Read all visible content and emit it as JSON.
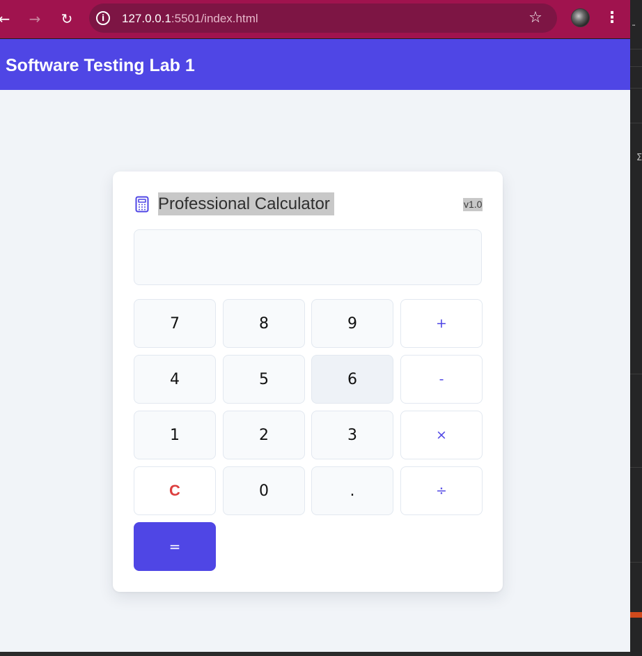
{
  "browser": {
    "url_host": "127.0.0.1",
    "url_rest": ":5501/index.html",
    "back_icon": "arrow-left-icon",
    "forward_icon": "arrow-right-icon",
    "reload_icon": "reload-icon",
    "bookmark_icon": "star-icon",
    "menu_icon": "kebab-menu-icon",
    "theme_color": "#a0134e"
  },
  "header": {
    "title": "Software Testing Lab 1",
    "color": "#4f46e5"
  },
  "calculator": {
    "title": "Professional Calculator",
    "version": "v1.0",
    "display_value": "",
    "keys": {
      "k7": "7",
      "k8": "8",
      "k9": "9",
      "plus": "+",
      "k4": "4",
      "k5": "5",
      "k6": "6",
      "minus": "-",
      "k1": "1",
      "k2": "2",
      "k3": "3",
      "multiply": "×",
      "clear": "C",
      "k0": "0",
      "dot": ".",
      "divide": "÷",
      "equals": "="
    },
    "accent_color": "#4f46e5",
    "clear_color": "#dc3f3f"
  }
}
